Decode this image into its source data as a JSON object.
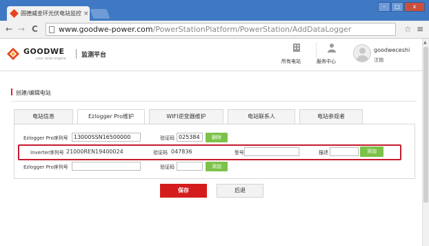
{
  "browser": {
    "tab_title": "固德威金环光伏电站监控",
    "tab_close": "×",
    "win_min": "–",
    "win_max": "□",
    "win_close": "x",
    "back": "←",
    "forward": "→",
    "reload": "C",
    "url_host": "www.goodwe-power.com",
    "url_path": "/PowerStationPlatform/PowerStation/AddDataLogger",
    "star": "☆",
    "menu": "≡"
  },
  "header": {
    "logo_text": "GOODWE",
    "logo_tagline": "your solar engine",
    "title": "监测平台",
    "nav": [
      {
        "label": "所有电站",
        "icon": "building-icon"
      },
      {
        "label": "服务中心",
        "icon": "person-icon"
      }
    ],
    "username": "goodweceshi",
    "logout": "注销"
  },
  "section": {
    "title": "创建/编辑电站"
  },
  "tabs": [
    {
      "label": "电站信息",
      "active": false
    },
    {
      "label": "Ezlogger Pro维护",
      "active": true
    },
    {
      "label": "WIFI逆变器维护",
      "active": false
    },
    {
      "label": "电站联系人",
      "active": false
    },
    {
      "label": "电站参观者",
      "active": false
    }
  ],
  "form": {
    "row1": {
      "serial_label": "Ezlogger Pro序列号",
      "serial_value": "13000SSN16500000",
      "code_label": "验证码",
      "code_value": "025384",
      "button": "删除"
    },
    "row2": {
      "serial_label": "Inverter序列号",
      "serial_value": "21000REN19400024",
      "code_label": "验证码",
      "code_value": "047836",
      "model_label": "型号",
      "model_value": "",
      "desc_label": "描述",
      "desc_value": "",
      "button": "添加"
    },
    "row3": {
      "serial_label": "Ezlogger Pro序列号",
      "serial_value": "",
      "code_label": "验证码",
      "code_value": "",
      "button": "添加"
    }
  },
  "actions": {
    "save": "保存",
    "back": "后退"
  },
  "colors": {
    "brand_red": "#d51c1c",
    "highlight": "#c5192d",
    "green": "#7cc24a",
    "chrome_blue": "#3f79c4"
  }
}
